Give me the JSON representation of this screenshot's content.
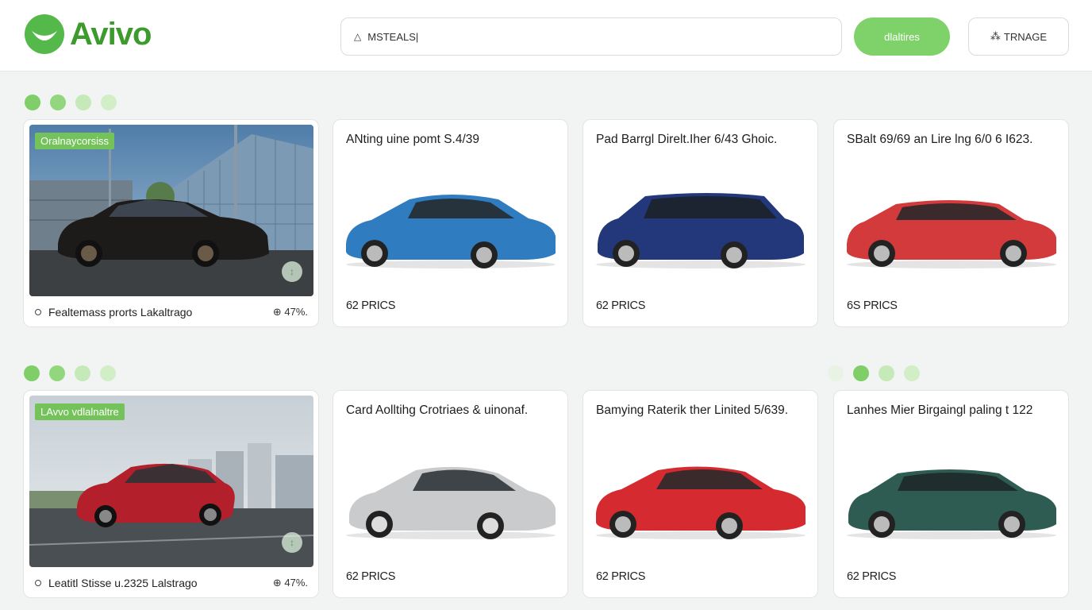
{
  "brand": {
    "name": "Avivo"
  },
  "header": {
    "search_value": "MSTEALS|",
    "primary_button": "dlaltires",
    "secondary_button": "TRNAGE"
  },
  "sections": [
    {
      "feature": {
        "tag": "Oralnaycorsiss",
        "footer_text": "Fealtemass prorts Lakaltrago",
        "footer_value": "⊕ 47%."
      },
      "cards": [
        {
          "title": "ANting uine pomt S.4/39",
          "price": "62 PRICS",
          "color": "#2f7cc0"
        },
        {
          "title": "Pad Barrgl Direlt.Iher 6/43 Ghoic.",
          "price": "62 PRICS",
          "color": "#22387a"
        },
        {
          "title": "SBalt 69/69 an Lire lng 6/0 6 I623.",
          "price": "6S PRICS",
          "color": "#d23a3b"
        }
      ]
    },
    {
      "feature": {
        "tag": "LAvvo vdlalnaltre",
        "footer_text": "Leatitl Stisse u.2325 Lalstrago",
        "footer_value": "⊕ 47%."
      },
      "cards": [
        {
          "title": "Card Aolltihg Crotriaes & uinonaf.",
          "price": "62 PRICS",
          "color": "#c9cbcc"
        },
        {
          "title": "Bamying Raterik ther Linited 5/639.",
          "price": "62 PRICS",
          "color": "#d52a30"
        },
        {
          "title": "Lanhes Mier Birgaingl paling t 122",
          "price": "62 PRICS",
          "color": "#2f5c52"
        }
      ]
    }
  ]
}
